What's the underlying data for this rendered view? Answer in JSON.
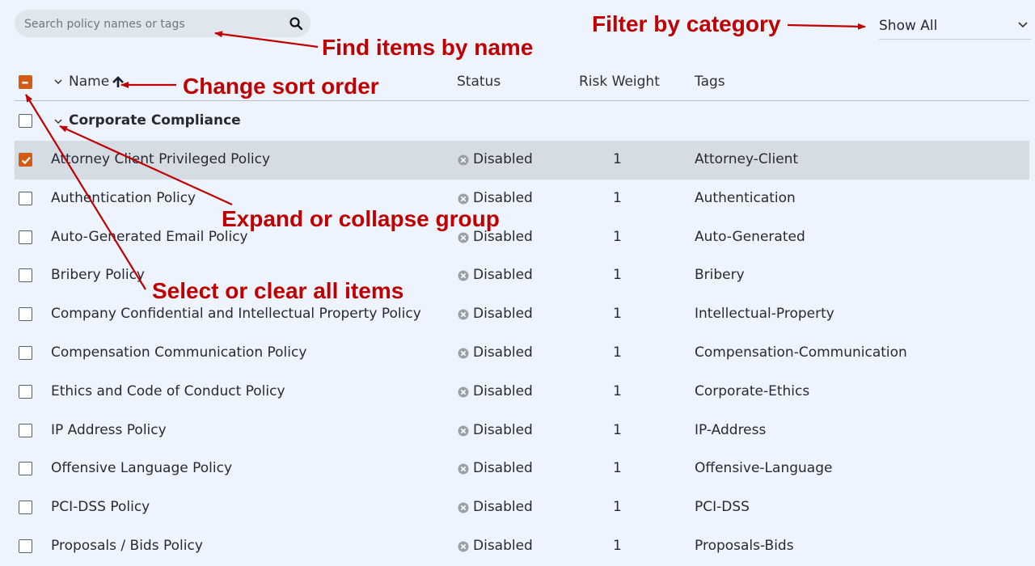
{
  "search": {
    "placeholder": "Search policy names or tags",
    "value": "",
    "icon": "search-icon"
  },
  "filter": {
    "value": "Show All"
  },
  "columns": {
    "name": "Name",
    "status": "Status",
    "risk": "Risk Weight",
    "tags": "Tags"
  },
  "group": {
    "label": "Corporate Compliance"
  },
  "rows": [
    {
      "name": "Attorney Client Privileged Policy",
      "status": "Disabled",
      "risk": "1",
      "tags": "Attorney-Client",
      "checked": true
    },
    {
      "name": "Authentication Policy",
      "status": "Disabled",
      "risk": "1",
      "tags": "Authentication",
      "checked": false
    },
    {
      "name": "Auto-Generated Email Policy",
      "status": "Disabled",
      "risk": "1",
      "tags": "Auto-Generated",
      "checked": false
    },
    {
      "name": "Bribery Policy",
      "status": "Disabled",
      "risk": "1",
      "tags": "Bribery",
      "checked": false
    },
    {
      "name": "Company Confidential and Intellectual Property Policy",
      "status": "Disabled",
      "risk": "1",
      "tags": "Intellectual-Property",
      "checked": false
    },
    {
      "name": "Compensation Communication Policy",
      "status": "Disabled",
      "risk": "1",
      "tags": "Compensation-Communication",
      "checked": false
    },
    {
      "name": "Ethics and Code of Conduct Policy",
      "status": "Disabled",
      "risk": "1",
      "tags": "Corporate-Ethics",
      "checked": false
    },
    {
      "name": "IP Address Policy",
      "status": "Disabled",
      "risk": "1",
      "tags": "IP-Address",
      "checked": false
    },
    {
      "name": "Offensive Language Policy",
      "status": "Disabled",
      "risk": "1",
      "tags": "Offensive-Language",
      "checked": false
    },
    {
      "name": "PCI-DSS Policy",
      "status": "Disabled",
      "risk": "1",
      "tags": "PCI-DSS",
      "checked": false
    },
    {
      "name": "Proposals / Bids Policy",
      "status": "Disabled",
      "risk": "1",
      "tags": "Proposals-Bids",
      "checked": false
    }
  ],
  "annotations": {
    "find": "Find items by name",
    "filter": "Filter by category",
    "sort": "Change sort order",
    "expand": "Expand or collapse group",
    "select": "Select or clear all items"
  },
  "colors": {
    "accent": "#d35b13",
    "annotation": "#c00000",
    "background": "#eef4fd",
    "selected_row": "#d6dce4"
  }
}
